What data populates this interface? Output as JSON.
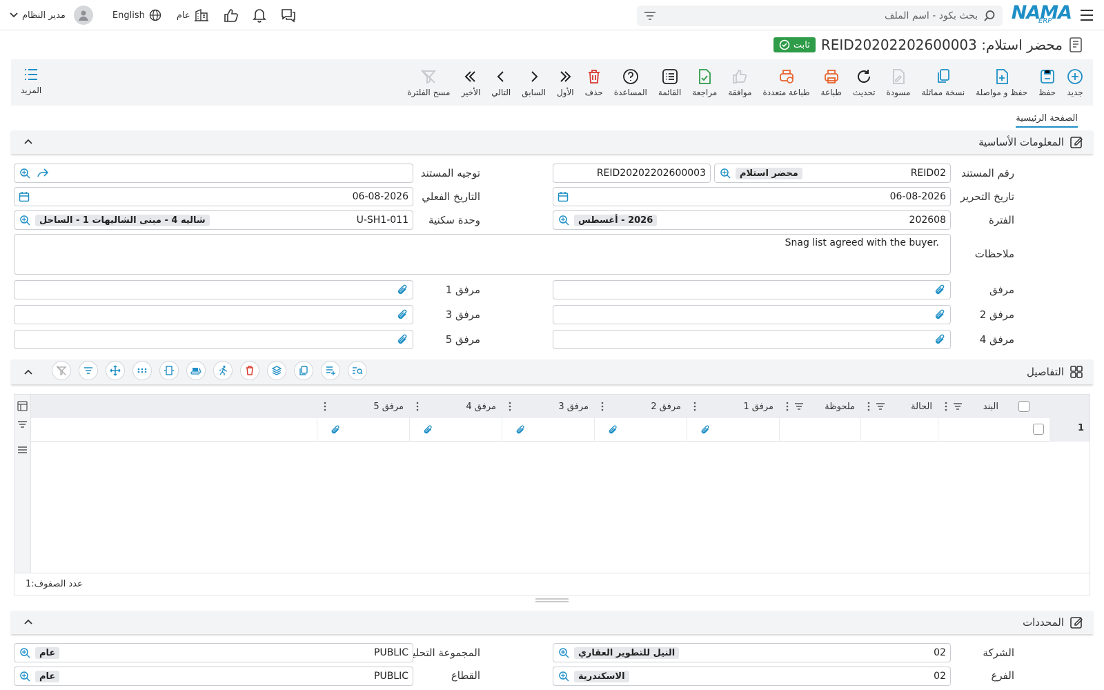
{
  "topbar": {
    "search_placeholder": "بحث بكود - اسم الملف",
    "language": "English",
    "company": "عام",
    "user": "مدير النظام",
    "logo_text": "NAMA",
    "logo_sub": "ERP"
  },
  "title": {
    "text": "محضر استلام: REID20202202600003",
    "status": "ثابت"
  },
  "toolbar": {
    "items": [
      "جديد",
      "حفظ",
      "حفظ و مواصلة",
      "نسخة مماثلة",
      "مسودة",
      "تحديث",
      "طباعة",
      "طباعة متعددة",
      "موافقة",
      "مراجعة",
      "القائمة",
      "المساعدة",
      "حذف",
      "الأول",
      "السابق",
      "التالي",
      "الأخير",
      "مسح الفلترة"
    ],
    "more": "المزيد"
  },
  "tabs": {
    "main": "الصفحة الرئيسية"
  },
  "sections": {
    "basic": "المعلومات الأساسية",
    "details": "التفاصيل",
    "determinants": "المحددات"
  },
  "form": {
    "doc_no_label": "رقم المستند",
    "doc_no_code": "REID02",
    "doc_no_type": "محضر استلام",
    "doc_no_value": "REID20202202600003",
    "direction_label": "توجيه المستند",
    "edit_date_label": "تاريخ التحرير",
    "edit_date": "06-08-2026",
    "actual_date_label": "التاريخ الفعلي",
    "actual_date": "06-08-2026",
    "period_label": "الفترة",
    "period_code": "202608",
    "period_name": "2026 - أغسطس",
    "unit_label": "وحدة سكنية",
    "unit_code": "U-SH1-011",
    "unit_name": "شاليه 4 - مبنى الشاليهات 1 - الساحل",
    "notes_label": "ملاحظات",
    "notes": "Snag list agreed with the buyer.",
    "att_label": "مرفق",
    "att1_label": "مرفق 1",
    "att2_label": "مرفق 2",
    "att3_label": "مرفق 3",
    "att4_label": "مرفق 4",
    "att5_label": "مرفق 5"
  },
  "grid": {
    "columns": [
      "البند",
      "الحالة",
      "ملحوظة",
      "مرفق 1",
      "مرفق 2",
      "مرفق 3",
      "مرفق 4",
      "مرفق 5"
    ],
    "row_number": "1",
    "footer": "عدد الصفوف:1"
  },
  "determinants": {
    "company_label": "الشركة",
    "company_code": "02",
    "company_name": "النيل للتطوير العقاري",
    "analytic_label": "المجموعة التحليلية",
    "analytic_code": "PUBLIC",
    "analytic_name": "عام",
    "branch_label": "الفرع",
    "branch_code": "02",
    "branch_name": "الاسكندرية",
    "sector_label": "القطاع",
    "sector_code": "PUBLIC",
    "sector_name": "عام"
  },
  "colors": {
    "accent": "#1e8fc6",
    "status_green": "#2e9c48",
    "print_orange": "#e8622a",
    "delete_red": "#d9372c",
    "review_green": "#2e9c48"
  }
}
